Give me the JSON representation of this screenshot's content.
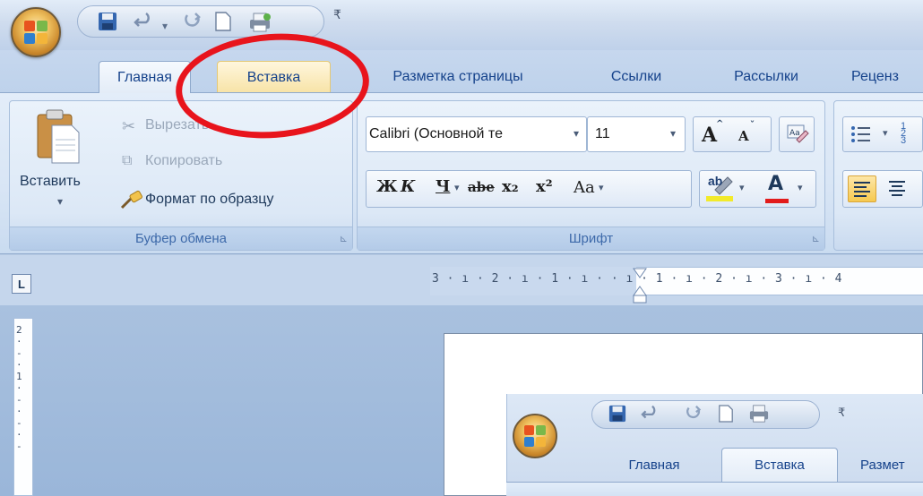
{
  "quick_access": {
    "icons": [
      "save-icon",
      "undo-icon",
      "redo-icon",
      "new-doc-icon",
      "print-icon"
    ],
    "more_glyph": "₹"
  },
  "tabs": [
    {
      "label": "Главная",
      "state": "active"
    },
    {
      "label": "Вставка",
      "state": "highlighted"
    },
    {
      "label": "Разметка страницы",
      "state": "normal"
    },
    {
      "label": "Ссылки",
      "state": "normal"
    },
    {
      "label": "Рассылки",
      "state": "normal"
    },
    {
      "label": "Реценз",
      "state": "normal"
    }
  ],
  "clipboard": {
    "paste_label": "Вставить",
    "paste_arrow": "▾",
    "cut_label": "Вырезать",
    "copy_label": "Копировать",
    "format_painter_label": "Формат по образцу",
    "group_label": "Буфер обмена"
  },
  "font": {
    "font_name": "Calibri (Основной те",
    "font_size": "11",
    "grow_label": "A",
    "shrink_label": "A",
    "bold": "Ж",
    "italic": "К",
    "underline": "Ч",
    "strikethrough": "abe",
    "subscript": "x₂",
    "superscript": "x²",
    "change_case": "Aa",
    "highlight": "ab",
    "font_color": "A",
    "group_label": "Шрифт"
  },
  "ruler": {
    "tab_selector": "L",
    "horizontal": "3 · ı · 2 · ı · 1 · ı ·   · ı · 1 · ı · 2 · ı · 3 · ı · 4",
    "vertical": "2\n·\n-\n·\n1\n·\n-\n·\n-\n·\n-"
  },
  "embedded": {
    "tabs": [
      {
        "label": "Главная",
        "state": "normal"
      },
      {
        "label": "Вставка",
        "state": "active"
      },
      {
        "label": "Размет",
        "state": "normal"
      }
    ]
  },
  "colors": {
    "highlight_ring": "#e8141c",
    "tab_text": "#15428b",
    "ribbon_bg": "#dce8f6"
  }
}
